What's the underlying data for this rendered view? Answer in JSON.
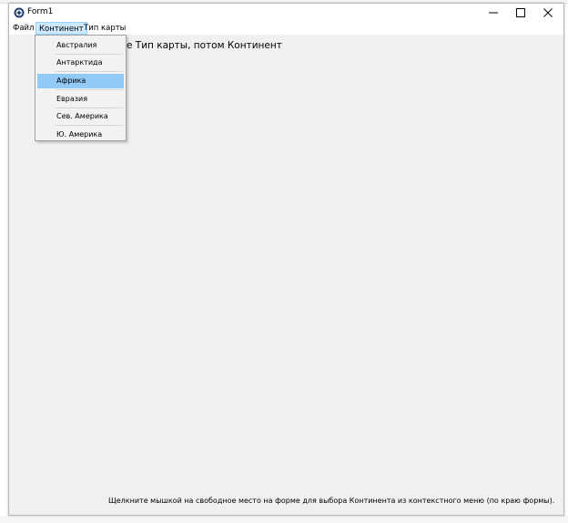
{
  "window": {
    "title": "Form1"
  },
  "menubar": {
    "items": [
      {
        "label": "Файл"
      },
      {
        "label": "Континент"
      },
      {
        "label": "Тип карты"
      }
    ]
  },
  "continent_menu": {
    "items": [
      {
        "label": "Австралия"
      },
      {
        "label": "Антарктида"
      },
      {
        "label": "Африка"
      },
      {
        "label": "Евразия"
      },
      {
        "label": "Сев. Америка"
      },
      {
        "label": "Ю. Америка"
      }
    ],
    "highlighted": "Африка"
  },
  "main": {
    "instruction_visible_text": "е Тип карты, потом Континент",
    "hint_text": "Щелкните мышкой на свободное место на форме для выбора Континента из контекстного меню (по краю формы)."
  },
  "colors": {
    "menu_open_bg": "#cce8ff",
    "menu_open_border": "#99d1ff",
    "item_highlight": "#91c9f7",
    "form_bg": "#f0f0f0"
  },
  "icons": [
    "app-icon",
    "minimize-icon",
    "maximize-icon",
    "close-icon"
  ]
}
